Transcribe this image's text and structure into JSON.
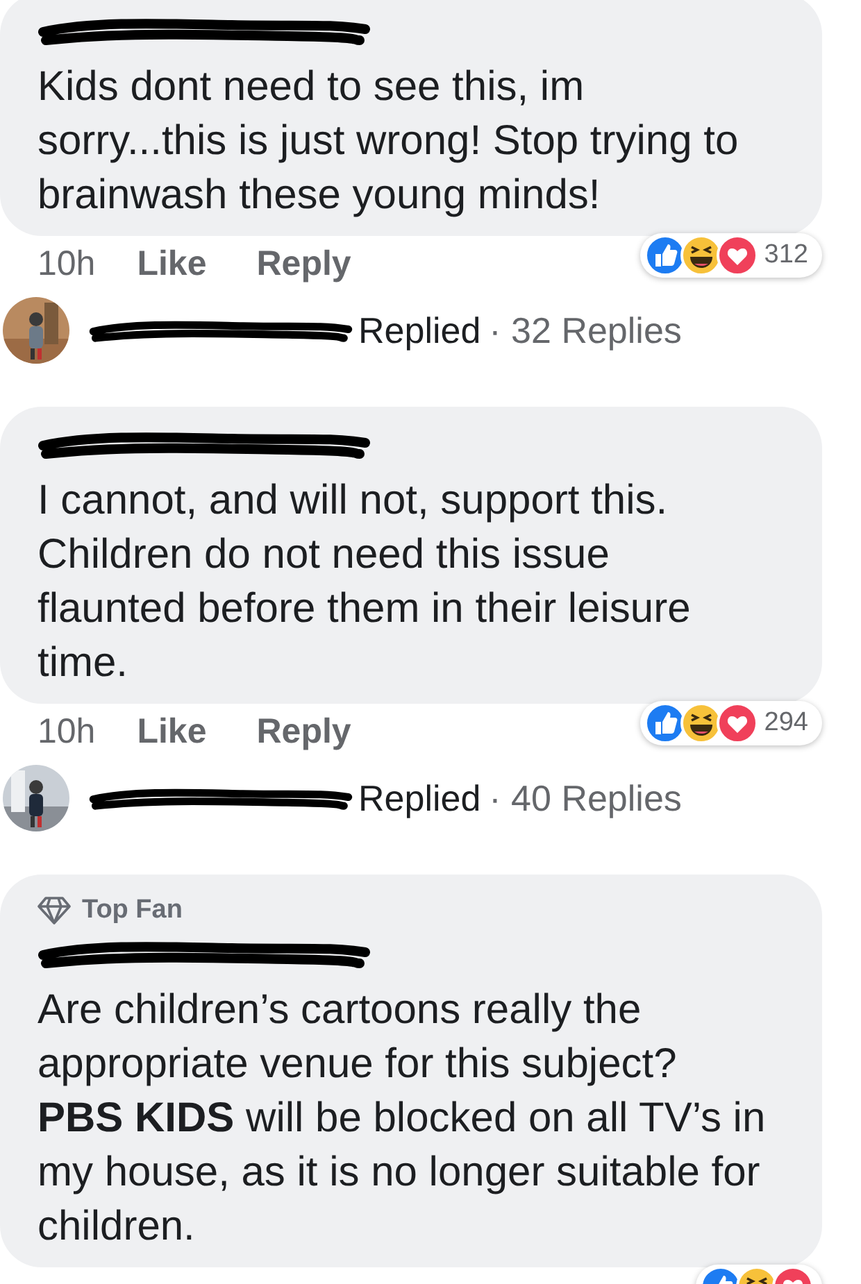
{
  "comments": [
    {
      "text": "Kids dont need to see this, im sorry...this is just wrong! Stop trying to brainwash these young minds!",
      "time": "10h",
      "like": "Like",
      "reply": "Reply",
      "has_reactions": true,
      "reactions": {
        "count": "312"
      },
      "replies": {
        "verb": "Replied",
        "count": "· 32 Replies"
      }
    },
    {
      "text": "I cannot, and will not, support this. Children do not need this issue flaunted before them in their leisure time.",
      "time": "10h",
      "like": "Like",
      "reply": "Reply",
      "has_reactions": true,
      "reactions": {
        "count": "294"
      },
      "replies": {
        "verb": "Replied",
        "count": "· 40 Replies"
      }
    },
    {
      "badge": "Top Fan",
      "text": "Are children’s cartoons really the appropriate venue for this subject? **PBS KIDS** will be blocked on all TV’s in my house, as it is no longer suitable for children.",
      "has_reactions": true
    }
  ]
}
